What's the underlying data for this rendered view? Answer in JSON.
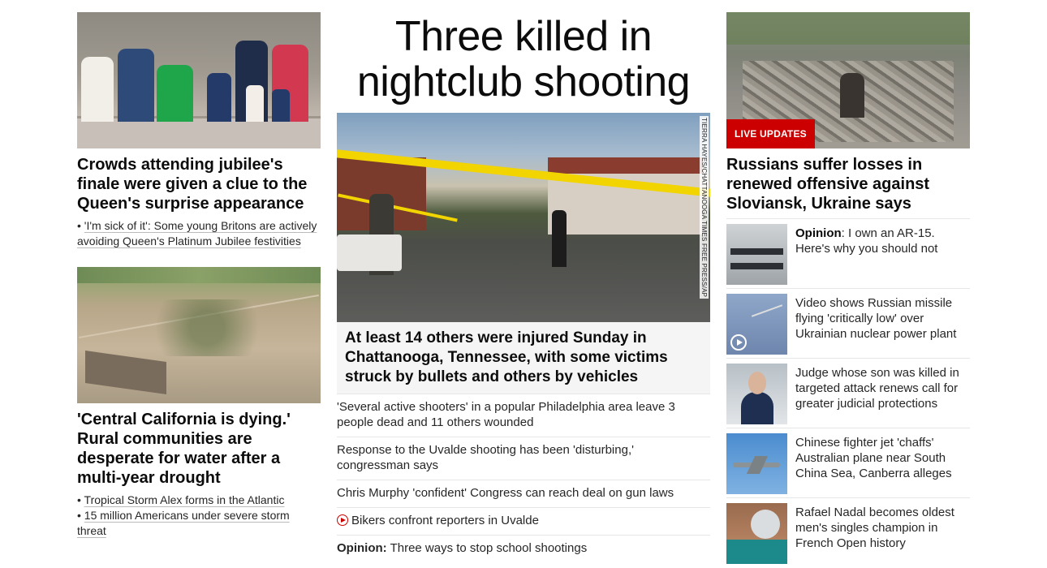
{
  "left": {
    "story1": {
      "headline": "Crowds attending jubilee's finale were given a clue to the Queen's surprise appearance",
      "links": [
        "'I'm sick of it': Some young Britons are actively avoiding Queen's Platinum Jubilee festivities"
      ]
    },
    "story2": {
      "headline": "'Central California is dying.' Rural communities are desperate for water after a multi-year drought",
      "links": [
        "Tropical Storm Alex forms in the Atlantic",
        "15 million Americans under severe storm threat"
      ]
    }
  },
  "center": {
    "title": "Three killed in nightclub shooting",
    "photo_credit": "TIERRA HAYES/CHATTANOOGA TIMES FREE PRESS/AP",
    "headline": "At least 14 others were injured Sunday in Chattanooga, Tennessee, with some victims struck by bullets and others by vehicles",
    "items": [
      {
        "text": "'Several active shooters' in a popular Philadelphia area leave 3 people dead and 11 others wounded"
      },
      {
        "text": "Response to the Uvalde shooting has been 'disturbing,' congressman says"
      },
      {
        "text": "Chris Murphy 'confident' Congress can reach deal on gun laws"
      },
      {
        "text": "Bikers confront reporters in Uvalde",
        "video": true
      },
      {
        "prefix": "Opinion:",
        "text": "Three ways to stop school shootings"
      }
    ]
  },
  "right": {
    "live_badge": "LIVE UPDATES",
    "headline": "Russians suffer losses in renewed offensive against Sloviansk, Ukraine says",
    "items": [
      {
        "prefix": "Opinion",
        "text": ": I own an AR-15. Here's why you should not",
        "thumb": "guns"
      },
      {
        "text": "Video shows Russian missile flying 'critically low' over Ukrainian nuclear power plant",
        "thumb": "missile",
        "video": true
      },
      {
        "text": "Judge whose son was killed in targeted attack renews call for greater judicial protections",
        "thumb": "judge"
      },
      {
        "text": "Chinese fighter jet 'chaffs' Australian plane near South China Sea, Canberra alleges",
        "thumb": "jet"
      },
      {
        "text": "Rafael Nadal becomes oldest men's singles champion in French Open history",
        "thumb": "nadal"
      }
    ]
  }
}
